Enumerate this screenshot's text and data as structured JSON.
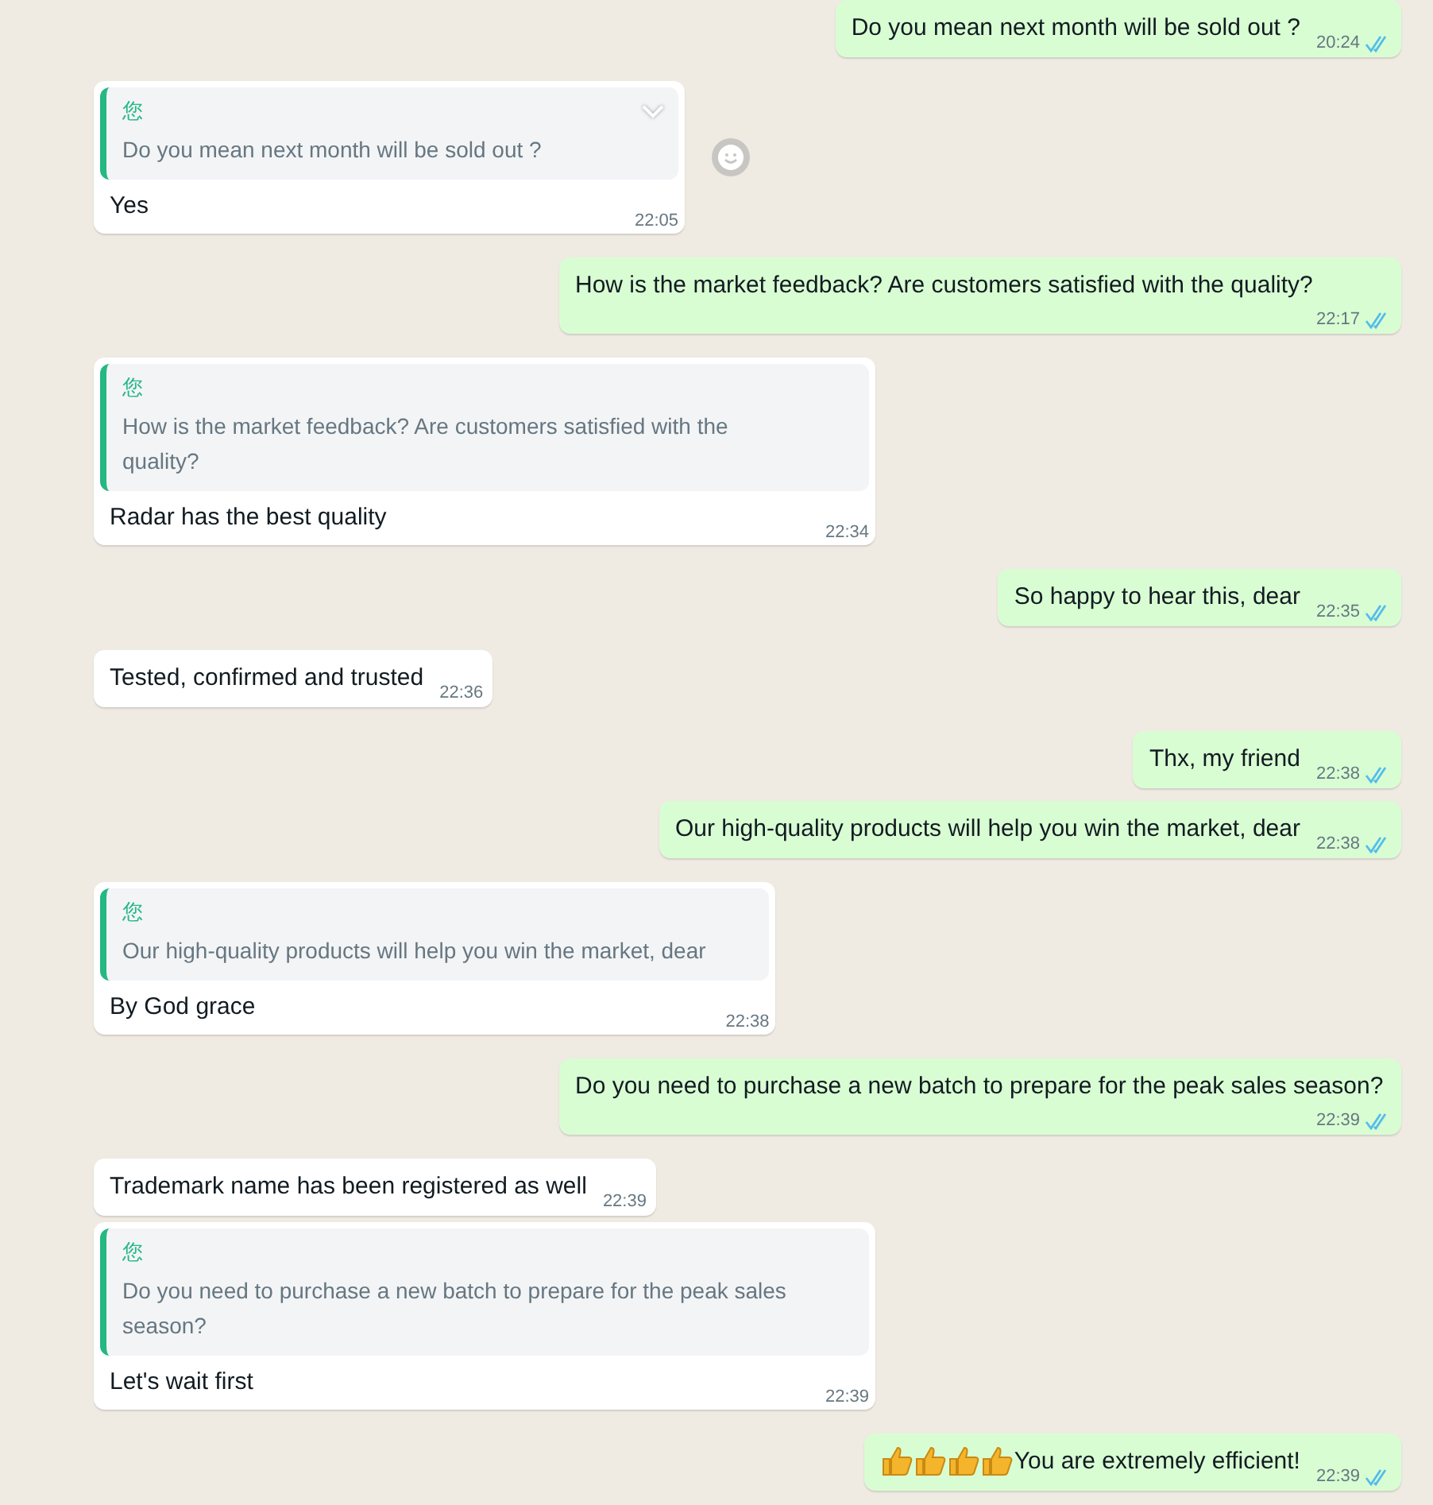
{
  "messages": [
    {
      "kind": "sent",
      "text": "Do you mean next month will be sold out ?",
      "time": "20:24",
      "read": true
    },
    {
      "kind": "received",
      "quote": {
        "author": "您",
        "text": "Do you mean next month will be sold out ?"
      },
      "text": "Yes",
      "time": "22:05",
      "menu_open": true,
      "react_button": true
    },
    {
      "kind": "sent",
      "text": "How is the market feedback? Are customers satisfied with the quality?",
      "time": "22:17",
      "read": true
    },
    {
      "kind": "received",
      "quote": {
        "author": "您",
        "text": "How is the market feedback? Are customers satisfied with the quality?"
      },
      "text": "Radar has the best quality",
      "time": "22:34"
    },
    {
      "kind": "sent",
      "text": "So happy to hear this, dear",
      "time": "22:35",
      "read": true
    },
    {
      "kind": "received",
      "text": "Tested, confirmed and trusted",
      "time": "22:36"
    },
    {
      "kind": "sent",
      "text": "Thx, my friend",
      "time": "22:38",
      "read": true
    },
    {
      "kind": "sent",
      "text": "Our high-quality products will help you win the market, dear",
      "time": "22:38",
      "read": true
    },
    {
      "kind": "received",
      "quote": {
        "author": "您",
        "text": "Our high-quality products will help you win the market, dear"
      },
      "text": "By God grace",
      "time": "22:38"
    },
    {
      "kind": "sent",
      "text": "Do you need to purchase a new batch to prepare for the peak sales season?",
      "time": "22:39",
      "read": true
    },
    {
      "kind": "received",
      "text": "Trademark name has been registered as well",
      "time": "22:39"
    },
    {
      "kind": "received",
      "quote": {
        "author": "您",
        "text": "Do you need to purchase a new batch to prepare for the peak sales season?"
      },
      "text": "Let's wait first",
      "time": "22:39"
    },
    {
      "kind": "sent",
      "emojis": [
        {
          "kind": "thumbs_up"
        },
        {
          "kind": "thumbs_up"
        },
        {
          "kind": "thumbs_up"
        },
        {
          "kind": "thumbs_up"
        }
      ],
      "text": "You are extremely efficient!",
      "time": "22:39",
      "read": true
    }
  ]
}
